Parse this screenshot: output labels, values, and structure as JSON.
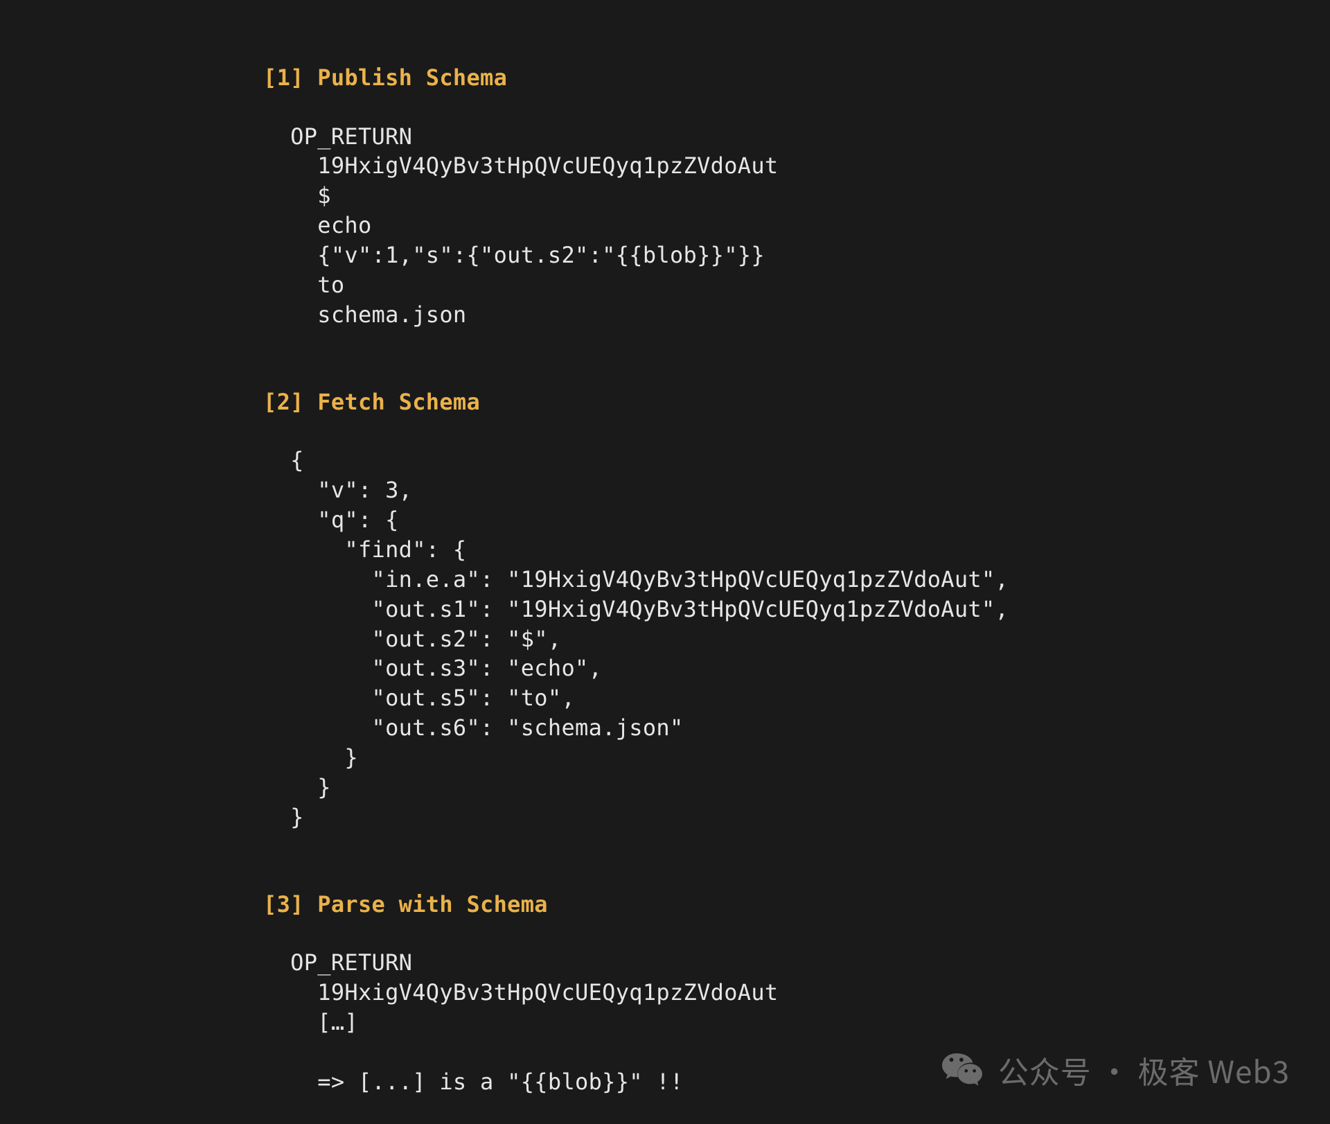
{
  "sections": [
    {
      "heading": "[1] Publish Schema",
      "code": "  OP_RETURN\n    19HxigV4QyBv3tHpQVcUEQyq1pzZVdoAut\n    $\n    echo\n    {\"v\":1,\"s\":{\"out.s2\":\"{{blob}}\"}}\n    to\n    schema.json"
    },
    {
      "heading": "[2] Fetch Schema",
      "code": "  {\n    \"v\": 3,\n    \"q\": {\n      \"find\": {\n        \"in.e.a\": \"19HxigV4QyBv3tHpQVcUEQyq1pzZVdoAut\",\n        \"out.s1\": \"19HxigV4QyBv3tHpQVcUEQyq1pzZVdoAut\",\n        \"out.s2\": \"$\",\n        \"out.s3\": \"echo\",\n        \"out.s5\": \"to\",\n        \"out.s6\": \"schema.json\"\n      }\n    }\n  }"
    },
    {
      "heading": "[3] Parse with Schema",
      "code": "  OP_RETURN\n    19HxigV4QyBv3tHpQVcUEQyq1pzZVdoAut\n    […]\n\n    => [...] is a \"{{blob}}\" !!"
    }
  ],
  "watermark": {
    "label": "公众号 · 极客 Web3"
  }
}
